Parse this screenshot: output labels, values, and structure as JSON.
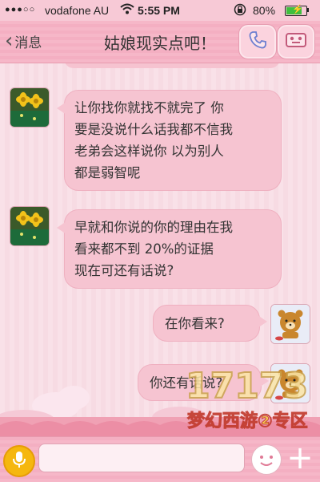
{
  "status_bar": {
    "signal": "●●●○○",
    "carrier": "vodafone AU",
    "time": "5:55 PM",
    "battery_percent": "80%",
    "battery_level": 0.8
  },
  "nav": {
    "back_label": "消息",
    "title": "姑娘现实点吧！",
    "phone_icon": "phone-icon",
    "profile_icon": "profile-card-icon"
  },
  "messages": [
    {
      "side": "left",
      "sender": "contact",
      "text": "让你找你就找不就完了  你\n要是没说什么话我都不信我\n老弟会这样说你  以为别人\n都是弱智呢"
    },
    {
      "side": "left",
      "sender": "contact",
      "text": "早就和你说的你的理由在我\n看来都不到 20%的证据\n现在可还有话说?"
    },
    {
      "side": "right",
      "sender": "me",
      "text": "在你看来?"
    },
    {
      "side": "right",
      "sender": "me",
      "text": "你还有话说?"
    }
  ],
  "input": {
    "value": "",
    "placeholder": ""
  },
  "watermark": {
    "number": "17173",
    "subtitle": "梦幻西游②专区"
  },
  "colors": {
    "nav_bg": "#f6b7c8",
    "bubble_bg": "#f6c4d1",
    "chat_bg": "#f9e1e8"
  }
}
